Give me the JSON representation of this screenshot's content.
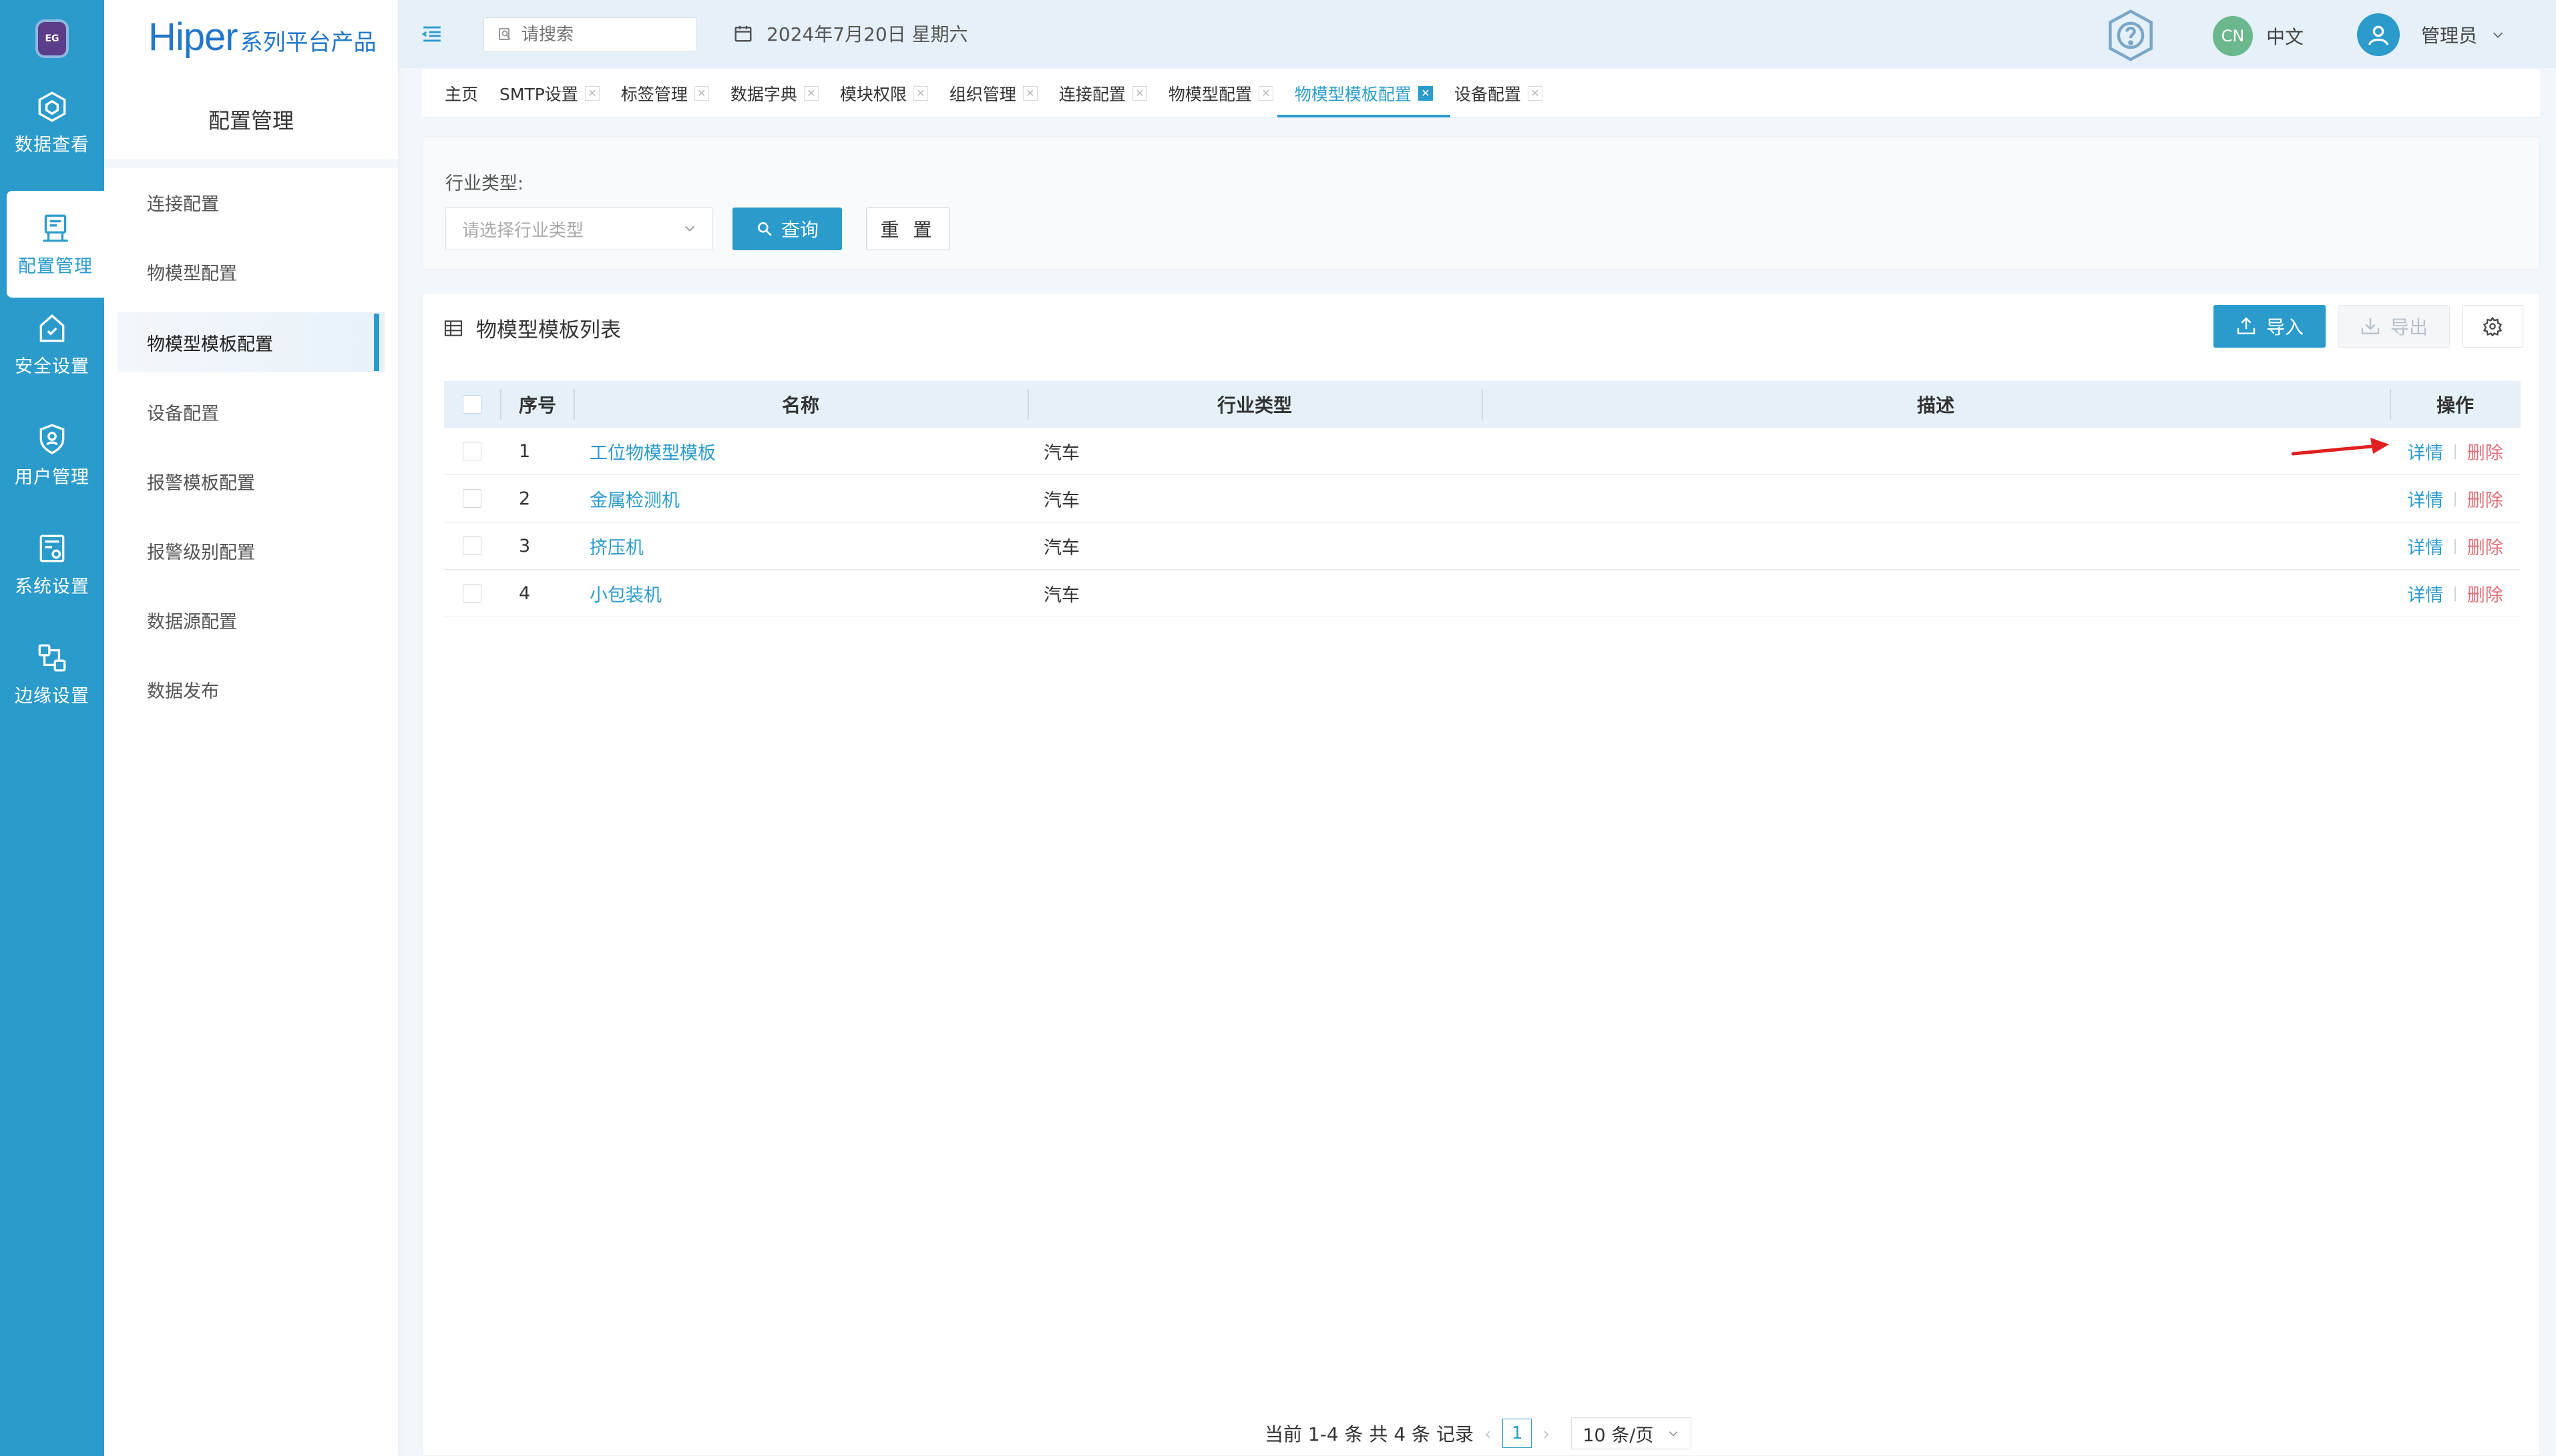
{
  "colors": {
    "accent": "#2b9bcb",
    "danger": "#e0707a",
    "annotation_arrow": "#e02020"
  },
  "rail": {
    "logo_text": "EG",
    "items": [
      {
        "label": "数据查看",
        "icon": "cube-icon",
        "active": false
      },
      {
        "label": "配置管理",
        "icon": "config-icon",
        "active": true
      },
      {
        "label": "安全设置",
        "icon": "security-icon",
        "active": false
      },
      {
        "label": "用户管理",
        "icon": "user-shield-icon",
        "active": false
      },
      {
        "label": "系统设置",
        "icon": "system-icon",
        "active": false
      },
      {
        "label": "边缘设置",
        "icon": "edge-icon",
        "active": false
      }
    ]
  },
  "sidebar": {
    "brand_main": "Hiper",
    "brand_sub": "系列平台产品",
    "title": "配置管理",
    "items": [
      {
        "label": "连接配置",
        "active": false
      },
      {
        "label": "物模型配置",
        "active": false
      },
      {
        "label": "物模型模板配置",
        "active": true
      },
      {
        "label": "设备配置",
        "active": false
      },
      {
        "label": "报警模板配置",
        "active": false
      },
      {
        "label": "报警级别配置",
        "active": false
      },
      {
        "label": "数据源配置",
        "active": false
      },
      {
        "label": "数据发布",
        "active": false
      }
    ]
  },
  "header": {
    "search_placeholder": "请搜索",
    "date": "2024年7月20日 星期六",
    "lang_badge": "CN",
    "lang_label": "中文",
    "user_label": "管理员"
  },
  "tabs": [
    {
      "label": "主页",
      "closable": false,
      "active": false
    },
    {
      "label": "SMTP设置",
      "closable": true,
      "active": false
    },
    {
      "label": "标签管理",
      "closable": true,
      "active": false
    },
    {
      "label": "数据字典",
      "closable": true,
      "active": false
    },
    {
      "label": "模块权限",
      "closable": true,
      "active": false
    },
    {
      "label": "组织管理",
      "closable": true,
      "active": false
    },
    {
      "label": "连接配置",
      "closable": true,
      "active": false
    },
    {
      "label": "物模型配置",
      "closable": true,
      "active": false
    },
    {
      "label": "物模型模板配置",
      "closable": true,
      "active": true
    },
    {
      "label": "设备配置",
      "closable": true,
      "active": false
    }
  ],
  "filter": {
    "label": "行业类型:",
    "select_placeholder": "请选择行业类型",
    "query_label": "查询",
    "reset_label": "重 置"
  },
  "list": {
    "title": "物模型模板列表",
    "import_label": "导入",
    "export_label": "导出",
    "columns": {
      "index": "序号",
      "name": "名称",
      "industry": "行业类型",
      "desc": "描述",
      "ops": "操作"
    },
    "op_detail": "详情",
    "op_delete": "删除",
    "rows": [
      {
        "index": "1",
        "name": "工位物模型模板",
        "industry": "汽车",
        "desc": ""
      },
      {
        "index": "2",
        "name": "金属检测机",
        "industry": "汽车",
        "desc": ""
      },
      {
        "index": "3",
        "name": "挤压机",
        "industry": "汽车",
        "desc": ""
      },
      {
        "index": "4",
        "name": "小包装机",
        "industry": "汽车",
        "desc": ""
      }
    ]
  },
  "pagination": {
    "summary": "当前 1-4 条 共 4 条 记录",
    "current_page": "1",
    "page_size": "10 条/页"
  }
}
